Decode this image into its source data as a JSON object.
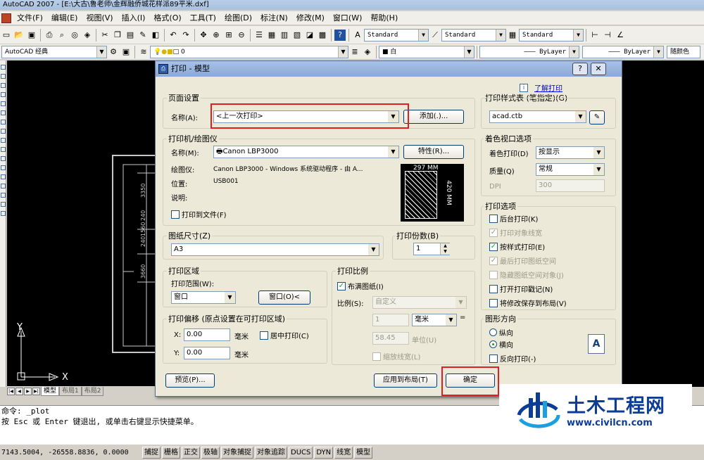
{
  "window": {
    "title": "AutoCAD 2007 - [E:\\大古\\鲁老师\\金辉融侨城花样派89平米.dxf]"
  },
  "menu": [
    "文件(F)",
    "编辑(E)",
    "视图(V)",
    "插入(I)",
    "格式(O)",
    "工具(T)",
    "绘图(D)",
    "标注(N)",
    "修改(M)",
    "窗口(W)",
    "帮助(H)"
  ],
  "toolbar": {
    "text_style": "Standard",
    "dim_style": "Standard",
    "table_style": "Standard",
    "workspace": "AutoCAD 经典",
    "layer": "0",
    "color": "白",
    "linetype": "ByLayer",
    "lineweight": "ByLayer",
    "plot_style": "随颜色"
  },
  "drawing": {
    "dim_labels": [
      "3350",
      "240",
      "1560",
      "240",
      "3660"
    ],
    "axis_x": "X",
    "axis_y": "Y"
  },
  "tabs": [
    "模型",
    "布局1",
    "布局2"
  ],
  "dialog": {
    "title": "打印 - 模型",
    "help_link": "了解打印",
    "page_setup": {
      "group": "页面设置",
      "name_label": "名称(A):",
      "name_value": "<上一次打印>",
      "add_button": "添加(.)..."
    },
    "printer": {
      "group": "打印机/绘图仪",
      "name_label": "名称(M):",
      "name_value": "Canon LBP3000",
      "properties_button": "特性(R)...",
      "plotter_label": "绘图仪:",
      "plotter_value": "Canon LBP3000 - Windows 系统驱动程序 - 由 A...",
      "location_label": "位置:",
      "location_value": "USB001",
      "desc_label": "说明:",
      "print_to_file": "打印到文件(F)",
      "preview_width": "297 MM",
      "preview_height": "420 MM"
    },
    "paper_size": {
      "group": "图纸尺寸(Z)",
      "value": "A3"
    },
    "copies": {
      "group": "打印份数(B)",
      "value": "1"
    },
    "plot_area": {
      "group": "打印区域",
      "range_label": "打印范围(W):",
      "range_value": "窗口",
      "window_button": "窗口(O)<"
    },
    "plot_offset": {
      "group": "打印偏移 (原点设置在可打印区域)",
      "x_label": "X:",
      "x_value": "0.00",
      "x_unit": "毫米",
      "y_label": "Y:",
      "y_value": "0.00",
      "y_unit": "毫米",
      "center": "居中打印(C)"
    },
    "plot_scale": {
      "group": "打印比例",
      "fit": "布满图纸(I)",
      "scale_label": "比例(S):",
      "scale_value": "自定义",
      "num_value": "1",
      "unit_value": "毫米",
      "eq": "=",
      "den_value": "58.45",
      "den_unit": "单位(U)",
      "lineweights": "缩放线宽(L)"
    },
    "plot_style_table": {
      "group": "打印样式表 (笔指定)(G)",
      "value": "acad.ctb"
    },
    "shaded_viewport": {
      "group": "着色视口选项",
      "shade_label": "着色打印(D)",
      "shade_value": "按显示",
      "quality_label": "质量(Q)",
      "quality_value": "常规",
      "dpi_label": "DPI",
      "dpi_value": "300"
    },
    "plot_options": {
      "group": "打印选项",
      "items": [
        {
          "label": "后台打印(K)",
          "checked": false,
          "enabled": true
        },
        {
          "label": "打印对象线宽",
          "checked": true,
          "enabled": false
        },
        {
          "label": "按样式打印(E)",
          "checked": true,
          "enabled": true
        },
        {
          "label": "最后打印图纸空间",
          "checked": true,
          "enabled": false
        },
        {
          "label": "隐藏图纸空间对象(J)",
          "checked": false,
          "enabled": false
        },
        {
          "label": "打开打印戳记(N)",
          "checked": false,
          "enabled": true
        },
        {
          "label": "将修改保存到布局(V)",
          "checked": false,
          "enabled": true
        }
      ]
    },
    "orientation": {
      "group": "图形方向",
      "portrait": "纵向",
      "landscape": "横向",
      "reverse": "反向打印(-)"
    },
    "buttons": {
      "preview": "预览(P)...",
      "apply": "应用到布局(T)",
      "ok": "确定"
    }
  },
  "command": {
    "line1": "命令: _plot",
    "line2": "按 Esc 或 Enter 键退出, 或单击右键显示快捷菜单。"
  },
  "status": {
    "coords": "7143.5004, -26558.8836, 0.0000",
    "buttons": [
      "捕捉",
      "栅格",
      "正交",
      "极轴",
      "对象捕捉",
      "对象追踪",
      "DUCS",
      "DYN",
      "线宽",
      "模型"
    ]
  },
  "watermark": {
    "title": "土木工程网",
    "url": "www.civilcn.com"
  },
  "colors": {
    "highlight": "#e02020",
    "brand": "#0c3c95"
  }
}
